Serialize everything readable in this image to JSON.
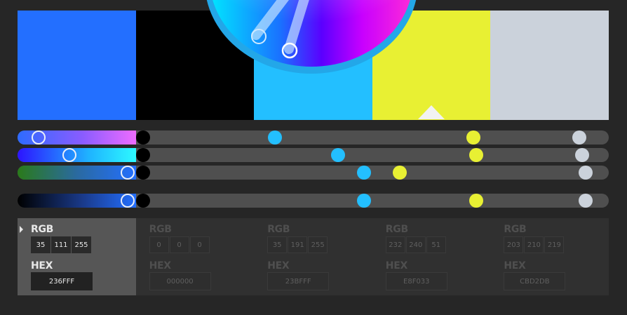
{
  "swatches": [
    {
      "hex": "#236FFF"
    },
    {
      "hex": "#000000"
    },
    {
      "hex": "#23BFFF"
    },
    {
      "hex": "#E8F033"
    },
    {
      "hex": "#CBD2DB"
    }
  ],
  "sliders": {
    "hue": {
      "gradient": [
        "#2e6bff",
        "#8a5cff",
        "#ee6cff"
      ],
      "markers_norm": [
        0.035,
        0.21,
        0.435,
        0.77,
        0.95
      ]
    },
    "saturation": {
      "gradient": [
        "#2d14ff",
        "#1fb3ff",
        "#2df9ff"
      ],
      "markers_norm": [
        0.087,
        0.21,
        0.545,
        0.775,
        0.955
      ]
    },
    "brightness": {
      "gradient": [
        "#2a7a1a",
        "#2a6aa0",
        "#236fff"
      ],
      "markers_norm": [
        0.185,
        0.21,
        0.592,
        0.645,
        0.96
      ]
    },
    "value": {
      "gradient": [
        "#000000",
        "#1a3a8a",
        "#236fff"
      ],
      "markers_norm": [
        0.185,
        0.21,
        0.592,
        0.775,
        0.96
      ]
    }
  },
  "colors": [
    {
      "rgb_label": "RGB",
      "r": "35",
      "g": "111",
      "b": "255",
      "hex_label": "HEX",
      "hex": "236FFF",
      "selected": true
    },
    {
      "rgb_label": "RGB",
      "r": "0",
      "g": "0",
      "b": "0",
      "hex_label": "HEX",
      "hex": "000000",
      "selected": false
    },
    {
      "rgb_label": "RGB",
      "r": "35",
      "g": "191",
      "b": "255",
      "hex_label": "HEX",
      "hex": "23BFFF",
      "selected": false
    },
    {
      "rgb_label": "RGB",
      "r": "232",
      "g": "240",
      "b": "51",
      "hex_label": "HEX",
      "hex": "E8F033",
      "selected": false
    },
    {
      "rgb_label": "RGB",
      "r": "203",
      "g": "210",
      "b": "219",
      "hex_label": "HEX",
      "hex": "CBD2DB",
      "selected": false
    }
  ]
}
